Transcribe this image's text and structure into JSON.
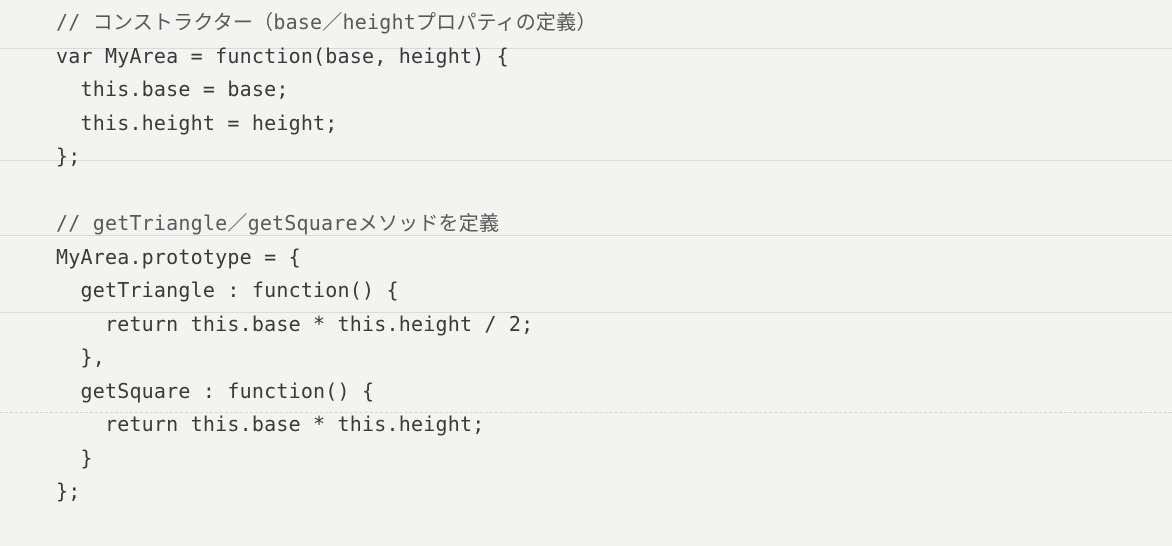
{
  "code": {
    "lines": [
      "// コンストラクター（base／heightプロパティの定義）",
      "var MyArea = function(base, height) {",
      "  this.base = base;",
      "  this.height = height;",
      "};",
      "",
      "// getTriangle／getSquareメソッドを定義",
      "MyArea.prototype = {",
      "  getTriangle : function() {",
      "    return this.base * this.height / 2;",
      "  },",
      "  getSquare : function() {",
      "    return this.base * this.height;",
      "  }",
      "};"
    ]
  }
}
